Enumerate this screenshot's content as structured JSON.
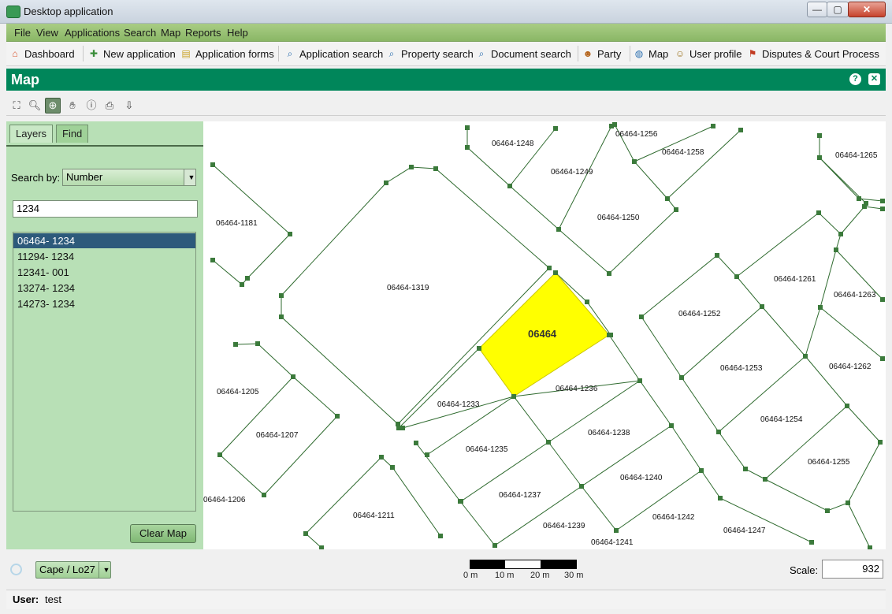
{
  "window": {
    "title": "Desktop application",
    "min": "—",
    "max": "▢",
    "close": "✕"
  },
  "menu": [
    "File",
    "View",
    "Applications",
    "Search",
    "Map",
    "Reports",
    "Help"
  ],
  "toolbar": [
    {
      "label": "Dashboard",
      "icon": "home-icon",
      "glyph": "⌂",
      "color": "#d9532c"
    },
    {
      "label": "New application",
      "icon": "new-document-icon",
      "glyph": "✚",
      "color": "#3a8d3a"
    },
    {
      "label": "Application forms",
      "icon": "forms-icon",
      "glyph": "▤",
      "color": "#c9a227"
    },
    {
      "label": "Application search",
      "icon": "search-icon",
      "glyph": "⌕",
      "color": "#2c6fb0"
    },
    {
      "label": "Property search",
      "icon": "search-icon",
      "glyph": "⌕",
      "color": "#2c6fb0"
    },
    {
      "label": "Document search",
      "icon": "search-icon",
      "glyph": "⌕",
      "color": "#2c6fb0"
    },
    {
      "label": "Party",
      "icon": "party-icon",
      "glyph": "☻",
      "color": "#b5651d"
    },
    {
      "label": "Map",
      "icon": "globe-icon",
      "glyph": "◍",
      "color": "#2c6fb0"
    },
    {
      "label": "User profile",
      "icon": "user-profile-icon",
      "glyph": "☺",
      "color": "#a07a2a"
    },
    {
      "label": "Disputes & Court Process",
      "icon": "gavel-icon",
      "glyph": "⚑",
      "color": "#c23b22"
    }
  ],
  "panel": {
    "title": "Map",
    "help": "?",
    "close": "✕"
  },
  "maptools": [
    {
      "name": "full-extent-icon",
      "glyph": "⛶"
    },
    {
      "name": "zoom-out-icon",
      "glyph": "🔍︎"
    },
    {
      "name": "zoom-in-icon",
      "glyph": "⊕",
      "active": true
    },
    {
      "name": "pan-hand-icon",
      "glyph": "✋︎"
    },
    {
      "name": "info-icon",
      "glyph": "ⓘ"
    },
    {
      "name": "print-icon",
      "glyph": "⎙"
    },
    {
      "name": "export-icon",
      "glyph": "⇩"
    }
  ],
  "sidebar": {
    "tabs": [
      {
        "label": "Layers"
      },
      {
        "label": "Find",
        "active": true
      }
    ],
    "search_by_label": "Search by:",
    "search_by_value": "Number",
    "search_value": "1234",
    "results": [
      "06464- 1234",
      "11294- 1234",
      "12341- 001",
      "13274- 1234",
      "14273- 1234"
    ],
    "selected_index": 0,
    "clear_map": "Clear Map"
  },
  "map": {
    "highlight_color": "#ffff00",
    "selected_parcel_label": "06464",
    "parcel_labels": [
      "06464-1248",
      "06464-1256",
      "06464-1258",
      "06464-1265",
      "06464-1249",
      "06464-1250",
      "06464-1181",
      "06464-1319",
      "06464-1261",
      "06464-1263",
      "06464-1252",
      "06464-1253",
      "06464-1262",
      "06464-1236",
      "06464-1233",
      "06464-1205",
      "06464-1207",
      "06464-1238",
      "06464-1254",
      "06464-1235",
      "06464-1255",
      "06464-1240",
      "06464-1237",
      "06464-1206",
      "06464-1211",
      "06464-1242",
      "06464-1239",
      "06464-1247",
      "06464-1241"
    ]
  },
  "status": {
    "srs": "Cape / Lo27",
    "scale_label": "Scale:",
    "scale_value": "932",
    "scale_ticks": [
      "0 m",
      "10 m",
      "20 m",
      "30 m"
    ]
  },
  "user": {
    "label": "User:",
    "value": "test"
  }
}
